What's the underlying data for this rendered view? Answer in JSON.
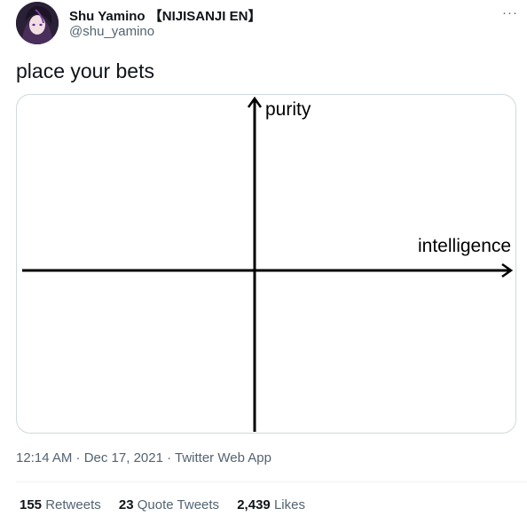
{
  "author": {
    "display_name": "Shu Yamino 【NIJISANJI EN】",
    "handle": "@shu_yamino",
    "avatar_icon": "profile-avatar"
  },
  "menu": {
    "more_label": "···"
  },
  "tweet": {
    "text": "place your bets",
    "image": {
      "y_axis_label": "purity",
      "x_axis_label": "intelligence"
    },
    "timestamp": "12:14 AM · Dec 17, 2021 · Twitter Web App"
  },
  "stats": {
    "retweets_count": "155",
    "retweets_label": "Retweets",
    "quotes_count": "23",
    "quotes_label": "Quote Tweets",
    "likes_count": "2,439",
    "likes_label": "Likes"
  },
  "colors": {
    "text_primary": "#0f1419",
    "text_secondary": "#536471",
    "border": "#cfd9de"
  }
}
